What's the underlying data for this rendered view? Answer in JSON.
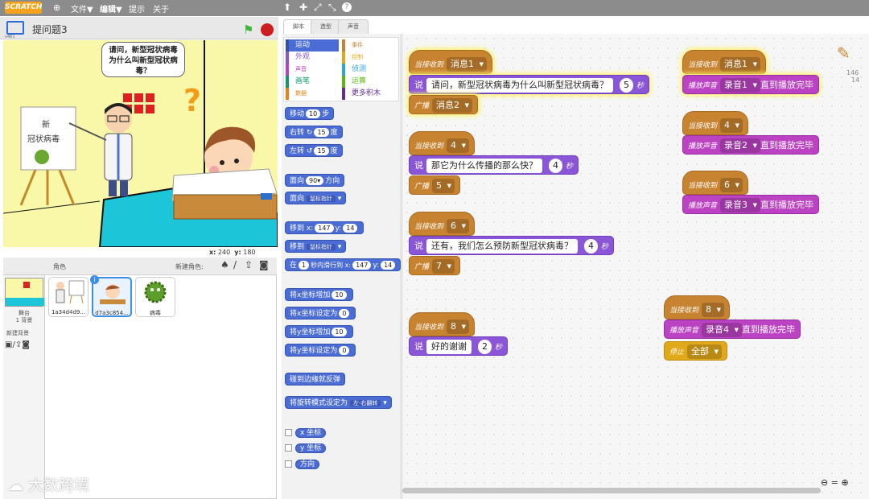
{
  "app": {
    "logo": "SCRATCH",
    "version": "v461"
  },
  "menu": {
    "file": "文件▼",
    "edit": "编辑▼",
    "tips": "提示",
    "about": "关于"
  },
  "stage": {
    "title": "提问题3",
    "speech": "请问，新型冠状病毒为什么叫新型冠状病毒？",
    "coords_x_label": "x:",
    "coords_x": "240",
    "coords_y_label": "y:",
    "coords_y": "180"
  },
  "sprites": {
    "header_label": "角色",
    "new_sprite_label": "新建角色:",
    "stage_label": "舞台",
    "stage_backdrops": "1 背景",
    "new_backdrop": "新建背景",
    "items": [
      {
        "name": "1a34d4d9..."
      },
      {
        "name": "d7a3c854..."
      },
      {
        "name": "病毒"
      }
    ]
  },
  "tabs": [
    "脚本",
    "造型",
    "声音"
  ],
  "categories": {
    "left": [
      "运动",
      "外观",
      "声音",
      "画笔",
      "数据"
    ],
    "right": [
      "事件",
      "控制",
      "侦测",
      "运算",
      "更多积木"
    ]
  },
  "palette": {
    "move": {
      "label": "移动",
      "val": "10",
      "unit": "步"
    },
    "turn_right": {
      "label": "右转",
      "val": "15",
      "unit": "度"
    },
    "turn_left": {
      "label": "左转",
      "val": "15",
      "unit": "度"
    },
    "point_dir": {
      "label": "面向",
      "val": "90▾",
      "unit": "方向"
    },
    "point_towards": {
      "label": "面向",
      "val": "鼠标指针"
    },
    "goto_xy": {
      "label": "移到 x:",
      "x": "147",
      "ylabel": "y:",
      "y": "14"
    },
    "goto": {
      "label": "移到",
      "val": "鼠标指针"
    },
    "glide": {
      "label": "在",
      "sec": "1",
      "mid": "秒内滑行到 x:",
      "x": "147",
      "ylabel": "y:",
      "y": "14"
    },
    "change_x": {
      "label": "将x坐标增加",
      "val": "10"
    },
    "set_x": {
      "label": "将x坐标设定为",
      "val": "0"
    },
    "change_y": {
      "label": "将y坐标增加",
      "val": "10"
    },
    "set_y": {
      "label": "将y坐标设定为",
      "val": "0"
    },
    "bounce": {
      "label": "碰到边缘就反弹"
    },
    "rotation": {
      "label": "将旋转模式设定为",
      "val": "左-右翻转"
    },
    "xpos": "x 坐标",
    "ypos": "y 坐标",
    "direction": "方向"
  },
  "scripts": {
    "when_receive": "当接收到",
    "say": "说",
    "secs": "秒",
    "broadcast": "广播",
    "play_sound": "播放声音",
    "until_done": "直到播放完毕",
    "stop": "停止",
    "s1": {
      "msg": "消息1",
      "text": "请问，新型冠状病毒为什么叫新型冠状病毒？",
      "secs": "5",
      "bc": "消息2"
    },
    "s2": {
      "msg": "4",
      "text": "那它为什么传播的那么快？",
      "secs": "4",
      "bc": "5"
    },
    "s3": {
      "msg": "6",
      "text": "还有，我们怎么预防新型冠状病毒？",
      "secs": "4",
      "bc": "7"
    },
    "s4": {
      "msg": "8",
      "text": "好的谢谢",
      "secs": "2"
    },
    "r1": {
      "msg": "消息1",
      "sound": "录音1"
    },
    "r2": {
      "msg": "4",
      "sound": "录音2"
    },
    "r3": {
      "msg": "6",
      "sound": "录音3"
    },
    "r4": {
      "msg": "8",
      "sound": "录音4",
      "stop": "全部"
    }
  },
  "sprite_info": {
    "x": "146",
    "y": "14"
  },
  "watermark": "大数跨境",
  "colors": {
    "motion": "#4a6cd4",
    "event": "#c88330",
    "looks": "#8a55d7",
    "sound": "#bb42c3",
    "control": "#e1a91a"
  }
}
